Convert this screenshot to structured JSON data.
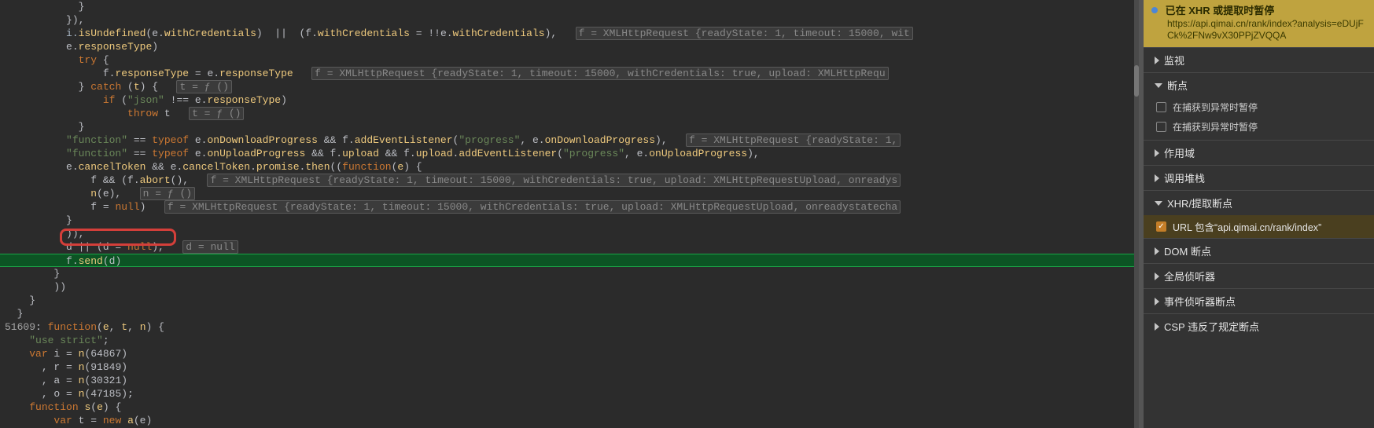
{
  "code": {
    "lines": [
      {
        "indent": 6,
        "segs": [
          [
            "pale",
            "}"
          ]
        ]
      },
      {
        "indent": 5,
        "segs": [
          [
            "pale",
            "}),"
          ]
        ]
      },
      {
        "indent": 5,
        "segs": [
          [
            "id",
            "i."
          ],
          [
            "fn",
            "isUndefined"
          ],
          [
            "pale",
            "(e."
          ],
          [
            "fn",
            "withCredentials"
          ],
          [
            "pale",
            ")  ||  (f."
          ],
          [
            "fn",
            "withCredentials"
          ],
          [
            "pale",
            " = !!e."
          ],
          [
            "fn",
            "withCredentials"
          ],
          [
            "pale",
            "),   "
          ],
          [
            "boxed",
            "f = XMLHttpRequest {readyState: 1, timeout: 15000, wit"
          ]
        ]
      },
      {
        "indent": 5,
        "segs": [
          [
            "pale",
            "e."
          ],
          [
            "fn",
            "responseType"
          ],
          [
            "pale",
            ")"
          ]
        ]
      },
      {
        "indent": 6,
        "segs": [
          [
            "kw",
            "try"
          ],
          [
            "pale",
            " {"
          ]
        ]
      },
      {
        "indent": 8,
        "segs": [
          [
            "pale",
            "f."
          ],
          [
            "fn",
            "responseType"
          ],
          [
            "pale",
            " = e."
          ],
          [
            "fn",
            "responseType"
          ],
          [
            "pale",
            "   "
          ],
          [
            "boxed",
            "f = XMLHttpRequest {readyState: 1, timeout: 15000, withCredentials: true, upload: XMLHttpRequ"
          ]
        ]
      },
      {
        "indent": 6,
        "segs": [
          [
            "pale",
            "} "
          ],
          [
            "kw",
            "catch"
          ],
          [
            "pale",
            " ("
          ],
          [
            "fn",
            "t"
          ],
          [
            "pale",
            ") {   "
          ],
          [
            "boxed",
            "t = ƒ ()"
          ]
        ]
      },
      {
        "indent": 8,
        "segs": [
          [
            "kw",
            "if"
          ],
          [
            "pale",
            " ("
          ],
          [
            "str",
            "\"json\""
          ],
          [
            "pale",
            " !== e."
          ],
          [
            "fn",
            "responseType"
          ],
          [
            "pale",
            ")"
          ]
        ]
      },
      {
        "indent": 10,
        "segs": [
          [
            "kw",
            "throw"
          ],
          [
            "pale",
            " t   "
          ],
          [
            "boxed",
            "t = ƒ ()"
          ]
        ]
      },
      {
        "indent": 6,
        "segs": [
          [
            "pale",
            "}"
          ]
        ]
      },
      {
        "indent": 5,
        "segs": [
          [
            "str",
            "\"function\""
          ],
          [
            "pale",
            " == "
          ],
          [
            "kw",
            "typeof"
          ],
          [
            "pale",
            " e."
          ],
          [
            "fn",
            "onDownloadProgress"
          ],
          [
            "pale",
            " && f."
          ],
          [
            "fn",
            "addEventListener"
          ],
          [
            "pale",
            "("
          ],
          [
            "str",
            "\"progress\""
          ],
          [
            "pale",
            ", e."
          ],
          [
            "fn",
            "onDownloadProgress"
          ],
          [
            "pale",
            "),   "
          ],
          [
            "boxed",
            "f = XMLHttpRequest {readyState: 1,"
          ]
        ]
      },
      {
        "indent": 5,
        "segs": [
          [
            "str",
            "\"function\""
          ],
          [
            "pale",
            " == "
          ],
          [
            "kw",
            "typeof"
          ],
          [
            "pale",
            " e."
          ],
          [
            "fn",
            "onUploadProgress"
          ],
          [
            "pale",
            " && f."
          ],
          [
            "fn",
            "upload"
          ],
          [
            "pale",
            " && f."
          ],
          [
            "fn",
            "upload"
          ],
          [
            "pale",
            "."
          ],
          [
            "fn",
            "addEventListener"
          ],
          [
            "pale",
            "("
          ],
          [
            "str",
            "\"progress\""
          ],
          [
            "pale",
            ", e."
          ],
          [
            "fn",
            "onUploadProgress"
          ],
          [
            "pale",
            "),"
          ]
        ]
      },
      {
        "indent": 5,
        "segs": [
          [
            "pale",
            "e."
          ],
          [
            "fn",
            "cancelToken"
          ],
          [
            "pale",
            " && e."
          ],
          [
            "fn",
            "cancelToken"
          ],
          [
            "pale",
            "."
          ],
          [
            "fn",
            "promise"
          ],
          [
            "pale",
            "."
          ],
          [
            "fn",
            "then"
          ],
          [
            "pale",
            "(("
          ],
          [
            "kw",
            "function"
          ],
          [
            "pale",
            "("
          ],
          [
            "fn",
            "e"
          ],
          [
            "pale",
            ") {"
          ]
        ]
      },
      {
        "indent": 7,
        "segs": [
          [
            "pale",
            "f && (f."
          ],
          [
            "fn",
            "abort"
          ],
          [
            "pale",
            "(),   "
          ],
          [
            "boxed",
            "f = XMLHttpRequest {readyState: 1, timeout: 15000, withCredentials: true, upload: XMLHttpRequestUpload, onreadys"
          ]
        ]
      },
      {
        "indent": 7,
        "segs": [
          [
            "fn",
            "n"
          ],
          [
            "pale",
            "(e),   "
          ],
          [
            "boxed",
            "n = ƒ ()"
          ]
        ]
      },
      {
        "indent": 7,
        "segs": [
          [
            "pale",
            "f = "
          ],
          [
            "kw",
            "null"
          ],
          [
            "pale",
            ")   "
          ],
          [
            "boxed",
            "f = XMLHttpRequest {readyState: 1, timeout: 15000, withCredentials: true, upload: XMLHttpRequestUpload, onreadystatecha"
          ]
        ]
      },
      {
        "indent": 5,
        "segs": [
          [
            "pale",
            "}"
          ]
        ]
      },
      {
        "indent": 5,
        "segs": [
          [
            "pale",
            ")),"
          ]
        ]
      },
      {
        "indent": 5,
        "segs": [
          [
            "pale",
            "d || (d = "
          ],
          [
            "kw",
            "null"
          ],
          [
            "pale",
            "),   "
          ],
          [
            "boxed",
            "d = null"
          ]
        ]
      },
      {
        "indent": 5,
        "exec": true,
        "segs": [
          [
            "pale",
            "f."
          ],
          [
            "fn",
            "send"
          ],
          [
            "pale",
            "(d)"
          ]
        ]
      },
      {
        "indent": 4,
        "segs": [
          [
            "pale",
            "}"
          ]
        ]
      },
      {
        "indent": 4,
        "segs": [
          [
            "pale",
            "))"
          ]
        ]
      },
      {
        "indent": 2,
        "segs": [
          [
            "pale",
            "}"
          ]
        ]
      },
      {
        "indent": 1,
        "segs": [
          [
            "pale",
            "}"
          ]
        ]
      },
      {
        "indent": 0,
        "segs": [
          [
            "lnumber",
            "51609"
          ],
          [
            "pale",
            ": "
          ],
          [
            "kw",
            "function"
          ],
          [
            "pale",
            "("
          ],
          [
            "fn",
            "e"
          ],
          [
            "pale",
            ", "
          ],
          [
            "fn",
            "t"
          ],
          [
            "pale",
            ", "
          ],
          [
            "fn",
            "n"
          ],
          [
            "pale",
            ") {"
          ]
        ]
      },
      {
        "indent": 2,
        "segs": [
          [
            "str",
            "\"use strict\""
          ],
          [
            "pale",
            ";"
          ]
        ]
      },
      {
        "indent": 2,
        "segs": [
          [
            "kw",
            "var"
          ],
          [
            "pale",
            " i = "
          ],
          [
            "fn",
            "n"
          ],
          [
            "pale",
            "(64867)"
          ]
        ]
      },
      {
        "indent": 3,
        "segs": [
          [
            "pale",
            ", r = "
          ],
          [
            "fn",
            "n"
          ],
          [
            "pale",
            "(91849)"
          ]
        ]
      },
      {
        "indent": 3,
        "segs": [
          [
            "pale",
            ", a = "
          ],
          [
            "fn",
            "n"
          ],
          [
            "pale",
            "(30321)"
          ]
        ]
      },
      {
        "indent": 3,
        "segs": [
          [
            "pale",
            ", o = "
          ],
          [
            "fn",
            "n"
          ],
          [
            "pale",
            "(47185);"
          ]
        ]
      },
      {
        "indent": 2,
        "segs": [
          [
            "kw",
            "function"
          ],
          [
            "pale",
            " "
          ],
          [
            "fn",
            "s"
          ],
          [
            "pale",
            "("
          ],
          [
            "fn",
            "e"
          ],
          [
            "pale",
            ") {"
          ]
        ]
      },
      {
        "indent": 4,
        "segs": [
          [
            "kw",
            "var"
          ],
          [
            "pale",
            " t = "
          ],
          [
            "kw",
            "new"
          ],
          [
            "pale",
            " "
          ],
          [
            "fn",
            "a"
          ],
          [
            "pale",
            "(e)"
          ]
        ]
      }
    ]
  },
  "pause": {
    "title": "已在 XHR 或提取时暂停",
    "url": "https://api.qimai.cn/rank/index?analysis=eDUjFCk%2FNw9vX30PPjZVQQA"
  },
  "sections": {
    "watch": {
      "label": "监视",
      "state": "right"
    },
    "breakpoints": {
      "label": "断点",
      "state": "down"
    },
    "bp_uncaught": {
      "label": "在捕获到异常时暂停"
    },
    "bp_caught": {
      "label": "在捕获到异常时暂停"
    },
    "scope": {
      "label": "作用域",
      "state": "right"
    },
    "callstack": {
      "label": "调用堆栈",
      "state": "right"
    },
    "xhr": {
      "label": "XHR/提取断点",
      "state": "down"
    },
    "xhr_item": {
      "label": "URL 包含“api.qimai.cn/rank/index”"
    },
    "dom": {
      "label": "DOM 断点",
      "state": "right"
    },
    "global": {
      "label": "全局侦听器",
      "state": "right"
    },
    "event": {
      "label": "事件侦听器断点",
      "state": "right"
    },
    "csp": {
      "label": "CSP 违反了规定断点",
      "state": "right"
    }
  }
}
